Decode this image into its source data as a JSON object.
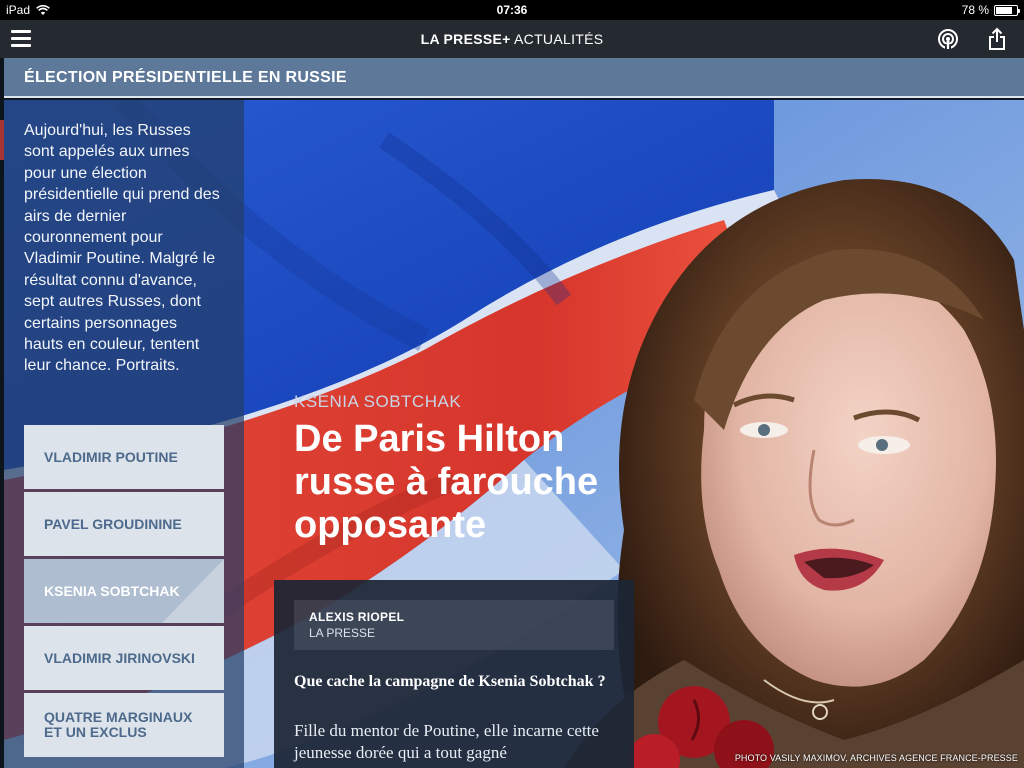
{
  "status_bar": {
    "device": "iPad",
    "time": "07:36",
    "battery": "78 %",
    "battery_level": 0.78
  },
  "app": {
    "brand_main": "LA PRESSE+",
    "brand_section": "ACTUALITÉS"
  },
  "section": {
    "title": "ÉLECTION PRÉSIDENTIELLE EN RUSSIE"
  },
  "sidebar": {
    "intro": "Aujourd'hui, les Russes sont appelés aux urnes pour une élection présidentielle qui prend des airs de dernier couronnement pour Vladimir Poutine. Malgré le résultat connu d'avance, sept autres Russes, dont certains personnages hauts en couleur, tentent leur chance. Portraits.",
    "items": [
      {
        "label": "VLADIMIR POUTINE",
        "active": false
      },
      {
        "label": "PAVEL GROUDININE",
        "active": false
      },
      {
        "label": "KSENIA SOBTCHAK",
        "active": true
      },
      {
        "label": "VLADIMIR JIRINOVSKI",
        "active": false
      },
      {
        "label": "QUATRE MARGINAUX ET UN EXCLUS",
        "active": false
      }
    ]
  },
  "article": {
    "kicker": "KSENIA SOBTCHAK",
    "headline": "De Paris Hilton russe à farouche opposante",
    "author": "ALEXIS RIOPEL",
    "outlet": "LA PRESSE",
    "question": "Que cache la campagne de Ksenia Sobtchak ?",
    "lede": "Fille du mentor de Poutine, elle incarne cette jeunesse dorée qui a tout gagné",
    "photo_credit": "PHOTO VASILY MAXIMOV, ARCHIVES AGENCE FRANCE-PRESSE"
  },
  "colors": {
    "section_banner": "#5d7898",
    "nav_bar": "#252a31",
    "flag_blue": "#1c4fc7",
    "flag_red": "#e0392f"
  },
  "icons": {
    "menu": "hamburger-icon",
    "podcast": "podcast-icon",
    "share": "share-icon",
    "wifi": "wifi-icon"
  }
}
